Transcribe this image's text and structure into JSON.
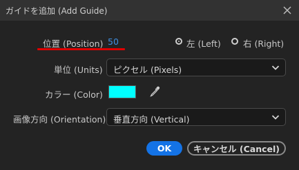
{
  "dialog": {
    "title": "ガイドを追加 (Add Guide)"
  },
  "position": {
    "label": "位置 (Position)",
    "value": "50"
  },
  "side": {
    "left_label": "左 (Left)",
    "right_label": "右 (Right)",
    "selected": "left"
  },
  "units": {
    "label": "単位 (Units)",
    "selected": "ピクセル (Pixels)"
  },
  "color": {
    "label": "カラー (Color)",
    "swatch": "#00FFFF"
  },
  "orientation": {
    "label": "画像方向 (Orientation)",
    "selected": "垂直方向 (Vertical)"
  },
  "buttons": {
    "ok": "OK",
    "cancel": "キャンセル (Cancel)"
  },
  "colors": {
    "accent": "#1473E6",
    "highlight_underline": "#E00000",
    "position_value": "#3F8FE0"
  }
}
